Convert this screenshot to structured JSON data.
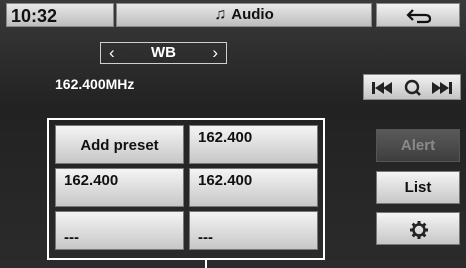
{
  "status": {
    "time": "10:32"
  },
  "header": {
    "title": "Audio",
    "title_icon": "music-note-icon",
    "back_icon": "back-arrow-icon"
  },
  "band": {
    "label": "WB",
    "prev_icon": "chevron-left-icon",
    "next_icon": "chevron-right-icon"
  },
  "frequency": "162.400MHz",
  "seek": {
    "prev_icon": "skip-back-icon",
    "scan_icon": "search-icon",
    "next_icon": "skip-forward-icon"
  },
  "presets": [
    {
      "label": "Add preset"
    },
    {
      "label": "162.400"
    },
    {
      "label": "162.400"
    },
    {
      "label": "162.400"
    },
    {
      "label": "---"
    },
    {
      "label": "---"
    }
  ],
  "side": {
    "alert": "Alert",
    "list": "List",
    "settings_icon": "gear-icon"
  },
  "colors": {
    "button_light": "#e6e6e6",
    "button_disabled": "#4a4a4a",
    "text_light": "#ffffff"
  }
}
